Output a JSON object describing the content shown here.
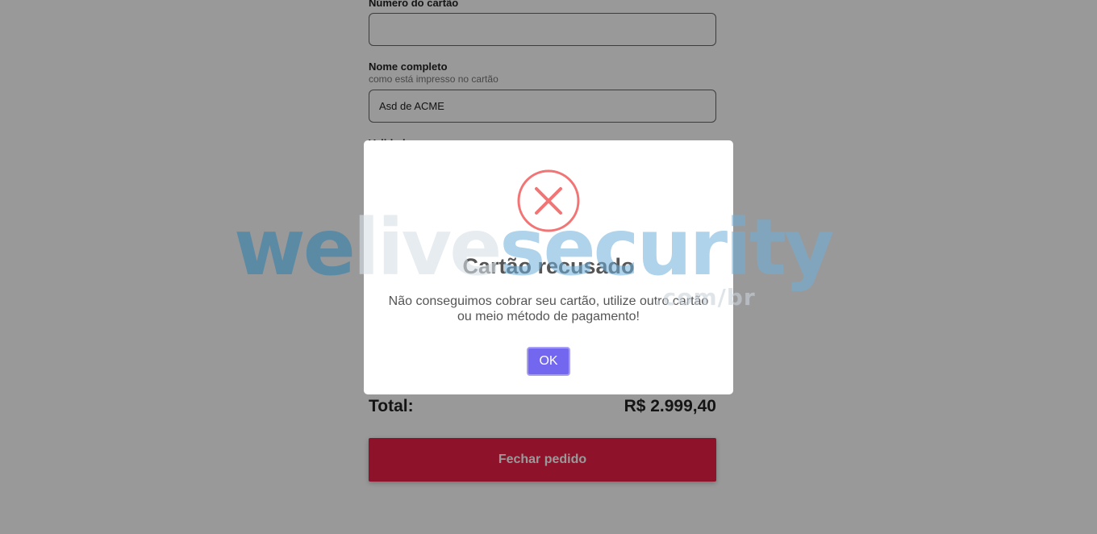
{
  "form": {
    "card_number_label": "Número do cartão",
    "card_number_value": "",
    "full_name_label": "Nome completo",
    "full_name_hint": "como está impresso no cartão",
    "full_name_value": "Asd de ACME",
    "validity_label": "Validade",
    "total_label": "Total:",
    "total_value": "R$ 2.999,40",
    "submit_label": "Fechar pedido"
  },
  "modal": {
    "icon": "error-x-icon",
    "title": "Cartão recusado",
    "message": "Não conseguimos cobrar seu cartão, utilize outro cartão ou meio método de pagamento!",
    "ok_label": "OK"
  },
  "watermark": {
    "part_we": "we",
    "part_live": "live",
    "part_security": "security",
    "tld": ".com/br"
  },
  "colors": {
    "overlay": "rgba(0,0,0,0.4)",
    "submit_button": "#ef1f48",
    "ok_button": "#7367f0",
    "error_icon": "#f27474",
    "watermark_we": "#2a7fb0",
    "watermark_live": "#d7e0e6",
    "watermark_security": "#6fb0dc"
  }
}
